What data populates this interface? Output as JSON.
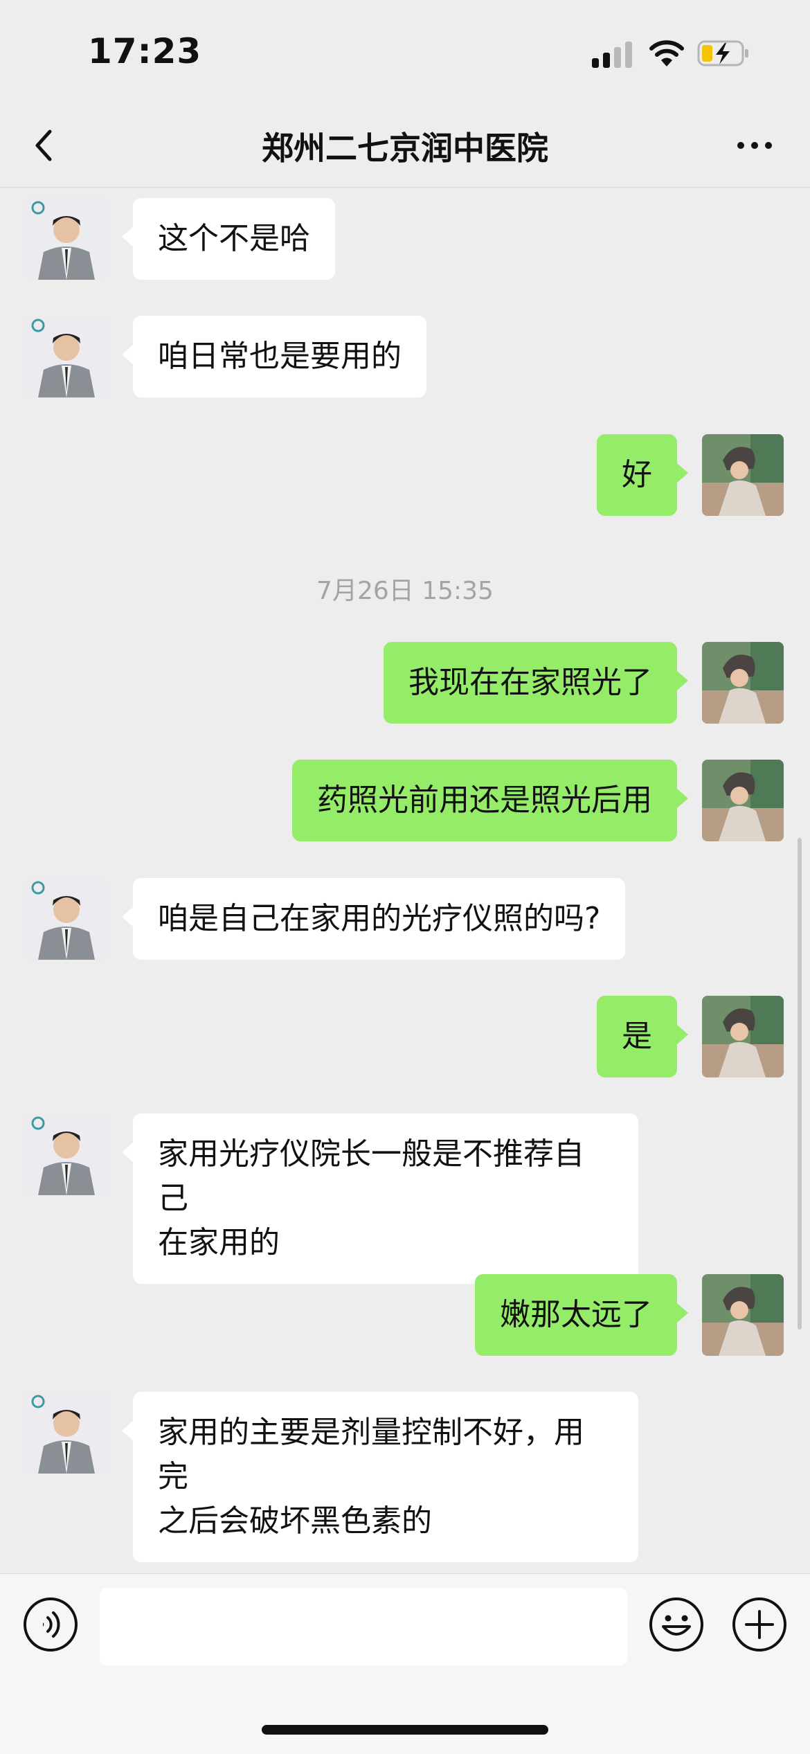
{
  "status_bar": {
    "time": "17:23"
  },
  "header": {
    "title": "郑州二七京润中医院"
  },
  "messages": [
    {
      "from": "doctor",
      "text": "这个不是哈"
    },
    {
      "from": "doctor",
      "text": "咱日常也是要用的"
    },
    {
      "from": "me",
      "text": "好"
    },
    {
      "timestamp": "7月26日 15:35"
    },
    {
      "from": "me",
      "text": "我现在在家照光了"
    },
    {
      "from": "me",
      "text": "药照光前用还是照光后用"
    },
    {
      "from": "doctor",
      "text": "咱是自己在家用的光疗仪照的吗?"
    },
    {
      "from": "me",
      "text": "是"
    },
    {
      "from": "doctor",
      "text": "家用光疗仪院长一般是不推荐自己\n在家用的"
    },
    {
      "from": "me",
      "text": "嫩那太远了"
    },
    {
      "from": "doctor",
      "text": "家用的主要是剂量控制不好，用完\n之后会破坏黑色素的"
    }
  ],
  "input": {
    "value": ""
  },
  "colors": {
    "background": "#ededed",
    "outgoing_bubble": "#95ec69",
    "incoming_bubble": "#ffffff"
  },
  "icons": [
    "back-icon",
    "more-icon",
    "voice-icon",
    "emoji-icon",
    "plus-icon",
    "signal-icon",
    "wifi-icon",
    "battery-icon"
  ]
}
